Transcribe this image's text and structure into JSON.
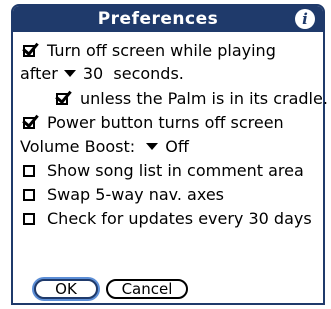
{
  "dialog": {
    "title": "Preferences",
    "info_glyph": "i"
  },
  "options": {
    "screen_off": {
      "checked": true,
      "label": "Turn off screen while playing"
    },
    "after": {
      "prefix": "after",
      "value": "30",
      "suffix": "seconds."
    },
    "cradle": {
      "checked": true,
      "label": "unless the Palm is in its cradle."
    },
    "power_button": {
      "checked": true,
      "label": "Power button turns off screen"
    },
    "volume_boost": {
      "label": "Volume Boost:",
      "value": "Off"
    },
    "song_list": {
      "checked": false,
      "label": "Show song list in comment area"
    },
    "swap_axes": {
      "checked": false,
      "label": "Swap 5-way nav. axes"
    },
    "updates": {
      "checked": false,
      "label": "Check for updates every 30 days"
    }
  },
  "buttons": {
    "ok": "OK",
    "cancel": "Cancel"
  },
  "colors": {
    "title_bar": "#1f3a6b",
    "focus_ring": "#5c8ed6"
  }
}
